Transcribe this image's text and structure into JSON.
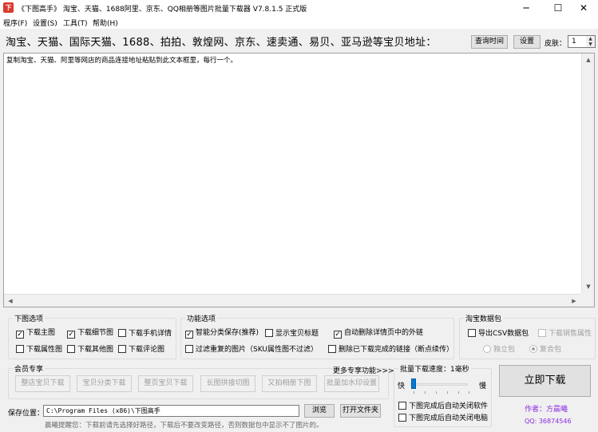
{
  "window": {
    "title": "《下图高手》 淘宝、天猫、1688阿里、京东、QQ相册等图片批量下载器 V7.8.1.5 正式版",
    "app_icon_glyph": "下",
    "minimize_glyph": "─",
    "maximize_glyph": "☐",
    "close_glyph": "✕"
  },
  "menu": [
    "程序(F)",
    "设置(S)",
    "工具(T)",
    "帮助(H)"
  ],
  "header": {
    "label": "淘宝、天猫、国际天猫、1688、拍拍、敦煌网、京东、速卖通、易贝、亚马逊等宝贝地址：",
    "query_time_button": "查询时间",
    "settings_button": "设置",
    "skin_label": "皮肤：",
    "skin_value": "1"
  },
  "textarea": {
    "content": "复制淘宝、天猫、阿里等网店的商品连接地址粘贴到此文本框里，每行一个。"
  },
  "download_options": {
    "legend": "下图选项",
    "items": [
      {
        "label": "下载主图",
        "checked": true
      },
      {
        "label": "下载细节图",
        "checked": true
      },
      {
        "label": "下载手机详情",
        "checked": false
      },
      {
        "label": "下载属性图",
        "checked": false
      },
      {
        "label": "下载其他图",
        "checked": false
      },
      {
        "label": "下载评论图",
        "checked": false
      }
    ]
  },
  "function_options": {
    "legend": "功能选项",
    "items": [
      {
        "label": "智能分类保存(推荐)",
        "checked": true
      },
      {
        "label": "显示宝贝标题",
        "checked": false
      },
      {
        "label": "自动删除详情页中的外链",
        "checked": true
      },
      {
        "label": "过滤重复的图片（SKU属性图不过滤）",
        "checked": false
      },
      {
        "label": "删除已下载完成的链接（断点续传）",
        "checked": false
      }
    ]
  },
  "taobao_data": {
    "legend": "淘宝数据包",
    "export_csv": "导出CSV数据包",
    "download_sales_attr": "下载销售属性",
    "standalone": "独立包",
    "combined": "复合包"
  },
  "member": {
    "legend": "会员专享",
    "more_label": "更多专享功能>>>",
    "buttons": [
      "整店宝贝下载",
      "宝贝分类下载",
      "整页宝贝下载",
      "长图拼接切图",
      "又拍相册下图",
      "批量加水印设置"
    ]
  },
  "speed": {
    "legend": "批量下载速度：1毫秒",
    "fast": "快",
    "slow": "慢",
    "value_ms": 1,
    "close_software": "下图完成后自动关闭软件",
    "shutdown": "下图完成后自动关闭电脑"
  },
  "save": {
    "label": "保存位置：",
    "path": "C:\\Program Files (x86)\\下图高手",
    "browse_button": "浏览",
    "open_folder_button": "打开文件夹"
  },
  "status_text": "晨曦提醒您：下载前请先选择好路径，下载后不要改变路径，否则数据包中显示不了图片的。",
  "download_button": "立即下载",
  "author": "作者：方晨曦",
  "qq": "QQ: 36874546",
  "colors": {
    "accent_blue": "#007ad9",
    "author_purple": "#8a2be2",
    "app_icon_red": "#d83a2f"
  }
}
